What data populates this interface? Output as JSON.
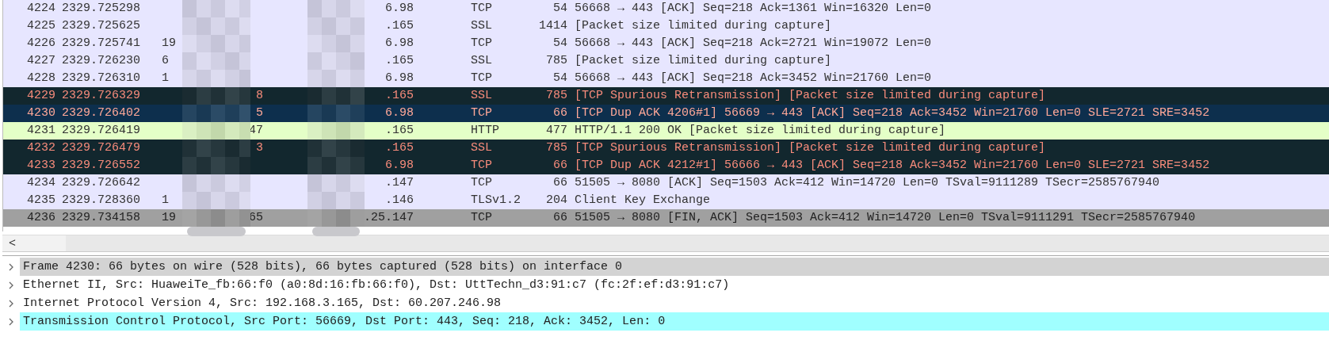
{
  "packets": [
    {
      "no": "4224",
      "time": "2329.725298",
      "destination": "6.98",
      "protocol": "TCP",
      "length": "54",
      "info": "56668 → 443 [ACK] Seq=218 Ack=1361 Win=16320 Len=0",
      "kind": "normal",
      "selected": false
    },
    {
      "no": "4225",
      "time": "2329.725625",
      "destination": ".165",
      "protocol": "SSL",
      "length": "1414",
      "info": "[Packet size limited during capture]",
      "kind": "normal",
      "selected": false
    },
    {
      "no": "4226",
      "time": "2329.725741",
      "source": "19",
      "destination": "6.98",
      "protocol": "TCP",
      "length": "54",
      "info": "56668 → 443 [ACK] Seq=218 Ack=2721 Win=19072 Len=0",
      "kind": "normal",
      "selected": false
    },
    {
      "no": "4227",
      "time": "2329.726230",
      "source": "6",
      "destination": ".165",
      "protocol": "SSL",
      "length": "785",
      "info": "[Packet size limited during capture]",
      "kind": "normal",
      "selected": false
    },
    {
      "no": "4228",
      "time": "2329.726310",
      "source": "1",
      "destination": "6.98",
      "protocol": "TCP",
      "length": "54",
      "info": "56668 → 443 [ACK] Seq=218 Ack=3452 Win=21760 Len=0",
      "kind": "normal",
      "selected": false
    },
    {
      "no": "4229",
      "time": "2329.726329",
      "source_tail": "8",
      "destination": ".165",
      "protocol": "SSL",
      "length": "785",
      "info": "[TCP Spurious Retransmission] [Packet size limited during capture]",
      "kind": "bad",
      "selected": false
    },
    {
      "no": "4230",
      "time": "2329.726402",
      "source_tail": "5",
      "destination": "6.98",
      "protocol": "TCP",
      "length": "66",
      "info": "[TCP Dup ACK 4206#1] 56669 → 443 [ACK] Seq=218 Ack=3452 Win=21760 Len=0 SLE=2721 SRE=3452",
      "kind": "bad",
      "selected": true
    },
    {
      "no": "4231",
      "time": "2329.726419",
      "source_tail": "47",
      "destination": ".165",
      "protocol": "HTTP",
      "length": "477",
      "info": "HTTP/1.1 200 OK [Packet size limited during capture]",
      "kind": "http",
      "selected": false
    },
    {
      "no": "4232",
      "time": "2329.726479",
      "source_tail": "3",
      "destination": ".165",
      "protocol": "SSL",
      "length": "785",
      "info": "[TCP Spurious Retransmission] [Packet size limited during capture]",
      "kind": "bad",
      "selected": false
    },
    {
      "no": "4233",
      "time": "2329.726552",
      "destination": "6.98",
      "protocol": "TCP",
      "length": "66",
      "info": "[TCP Dup ACK 4212#1] 56666 → 443 [ACK] Seq=218 Ack=3452 Win=21760 Len=0 SLE=2721 SRE=3452",
      "kind": "bad",
      "selected": false
    },
    {
      "no": "4234",
      "time": "2329.726642",
      "destination": ".147",
      "protocol": "TCP",
      "length": "66",
      "info": "51505 → 8080 [ACK] Seq=1503 Ack=412 Win=14720 Len=0 TSval=9111289 TSecr=2585767940",
      "kind": "normal",
      "selected": false
    },
    {
      "no": "4235",
      "time": "2329.728360",
      "source": "1",
      "destination": ".146",
      "protocol": "TLSv1.2",
      "length": "204",
      "info": "Client Key Exchange",
      "kind": "normal",
      "selected": false
    },
    {
      "no": "4236",
      "time": "2329.734158",
      "source": "19",
      "source_tail": "65",
      "destination": ".25.147",
      "protocol": "TCP",
      "length": "66",
      "info": "51505 → 8080 [FIN, ACK] Seq=1503 Ack=412 Win=14720 Len=0 TSval=9111291 TSecr=2585767940",
      "kind": "fin",
      "selected": false
    }
  ],
  "scrollbar": {
    "left_arrow": "<"
  },
  "details": [
    {
      "text": "Frame 4230: 66 bytes on wire (528 bits), 66 bytes captured (528 bits) on interface 0",
      "expanded": false,
      "color": "#d3d3d3"
    },
    {
      "text": "Ethernet II, Src: HuaweiTe_fb:66:f0 (a0:8d:16:fb:66:f0), Dst: UttTechn_d3:91:c7 (fc:2f:ef:d3:91:c7)",
      "expanded": false,
      "color": "#ffffff"
    },
    {
      "text": "Internet Protocol Version 4, Src: 192.168.3.165, Dst: 60.207.246.98",
      "expanded": false,
      "color": "#ffffff"
    },
    {
      "text": "Transmission Control Protocol, Src Port: 56669, Dst Port: 443, Seq: 218, Ack: 3452, Len: 0",
      "expanded": false,
      "color": "#a0ffff"
    }
  ]
}
